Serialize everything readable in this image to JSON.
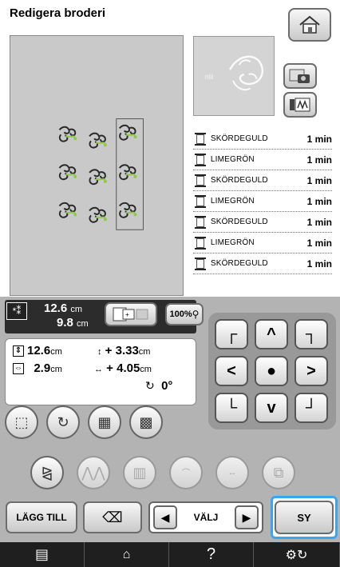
{
  "title": "Redigera broderi",
  "home_button_icon": "home-icon",
  "preview_text": "nlii",
  "side_buttons": [
    {
      "icon": "camera-icon"
    },
    {
      "icon": "thread-display-icon"
    }
  ],
  "threads": [
    {
      "name": "SKÖRDEGULD",
      "time": "1 min",
      "color": "#c4a35a"
    },
    {
      "name": "LIMEGRÖN",
      "time": "1 min",
      "color": "#7fbf3f"
    },
    {
      "name": "SKÖRDEGULD",
      "time": "1 min",
      "color": "#c4a35a"
    },
    {
      "name": "LIMEGRÖN",
      "time": "1 min",
      "color": "#7fbf3f"
    },
    {
      "name": "SKÖRDEGULD",
      "time": "1 min",
      "color": "#c4a35a"
    },
    {
      "name": "LIMEGRÖN",
      "time": "1 min",
      "color": "#7fbf3f"
    },
    {
      "name": "SKÖRDEGULD",
      "time": "1 min",
      "color": "#c4a35a"
    }
  ],
  "size": {
    "height_value": "12.6",
    "width_value": "9.8",
    "unit": "cm"
  },
  "zoom_label": "100%",
  "info": {
    "height_value": "12.6",
    "width_value": "2.9",
    "unit": "cm",
    "offset_v": "+ 3.33",
    "offset_h": "+ 4.05",
    "rotation": "0°"
  },
  "buttons": {
    "lagg_till": "LÄGG TILL",
    "valj": "VÄLJ",
    "sy": "SY"
  },
  "bottom_bar": {
    "help": "?"
  }
}
